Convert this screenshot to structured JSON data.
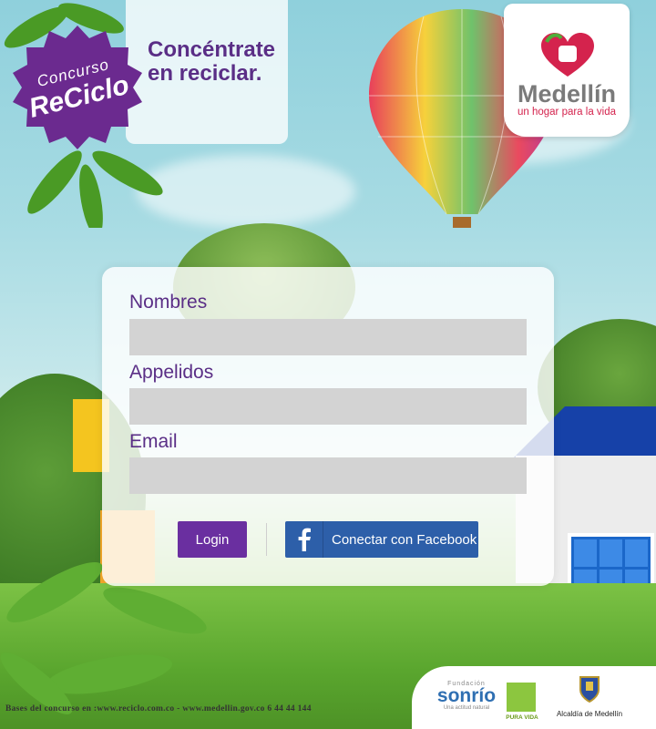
{
  "header": {
    "badge": {
      "line1": "Concurso",
      "line2": "ReCiclo"
    },
    "tagline": "Concéntrate en reciclar.",
    "brand": {
      "name": "Medellín",
      "subtitle": "un hogar para la vida"
    }
  },
  "form": {
    "fields": [
      {
        "label": "Nombres",
        "value": "",
        "placeholder": ""
      },
      {
        "label": "Appelidos",
        "value": "",
        "placeholder": ""
      },
      {
        "label": "Email",
        "value": "",
        "placeholder": ""
      }
    ],
    "login_label": "Login",
    "facebook_label": "Conectar con Facebook"
  },
  "footer": {
    "text": "Bases del concurso en :www.reciclo.com.co - www.medellin.gov.co 6 44 44 144",
    "sponsors": {
      "sonrio_top": "Fundación",
      "sonrio_main": "sonrío",
      "sonrio_sub": "Una actitud natural",
      "pura_vida": "PURA VIDA",
      "alcaldia": "Alcaldía de Medellín"
    }
  },
  "colors": {
    "accent": "#5a2e86",
    "login_button": "#6a2fa0",
    "facebook_button": "#2d5fa9",
    "input_bg": "#d3d3d3",
    "brand_red": "#d4234d"
  }
}
